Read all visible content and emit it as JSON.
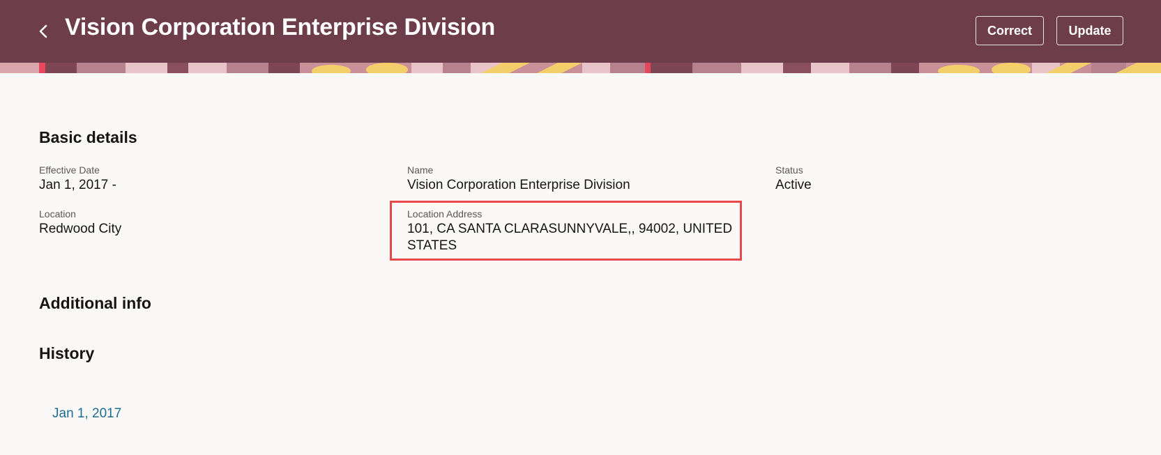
{
  "header": {
    "title": "Vision Corporation Enterprise Division",
    "back_icon": "chevron-left-icon",
    "background_color": "#6e3d4b",
    "buttons": {
      "correct_label": "Correct",
      "update_label": "Update"
    }
  },
  "basic_details": {
    "heading": "Basic details",
    "effective_date": {
      "label": "Effective Date",
      "value": "Jan 1, 2017 -"
    },
    "name": {
      "label": "Name",
      "value": "Vision Corporation Enterprise Division"
    },
    "status": {
      "label": "Status",
      "value": "Active"
    },
    "location": {
      "label": "Location",
      "value": "Redwood City"
    },
    "location_address": {
      "label": "Location Address",
      "value": "101, CA SANTA CLARASUNNYVALE,, 94002, UNITED STATES",
      "highlight_color": "#e8474b"
    }
  },
  "additional_info": {
    "heading": "Additional info"
  },
  "history": {
    "heading": "History",
    "entries": [
      {
        "label": "Jan 1, 2017"
      }
    ],
    "link_color": "#1f6c8f"
  }
}
